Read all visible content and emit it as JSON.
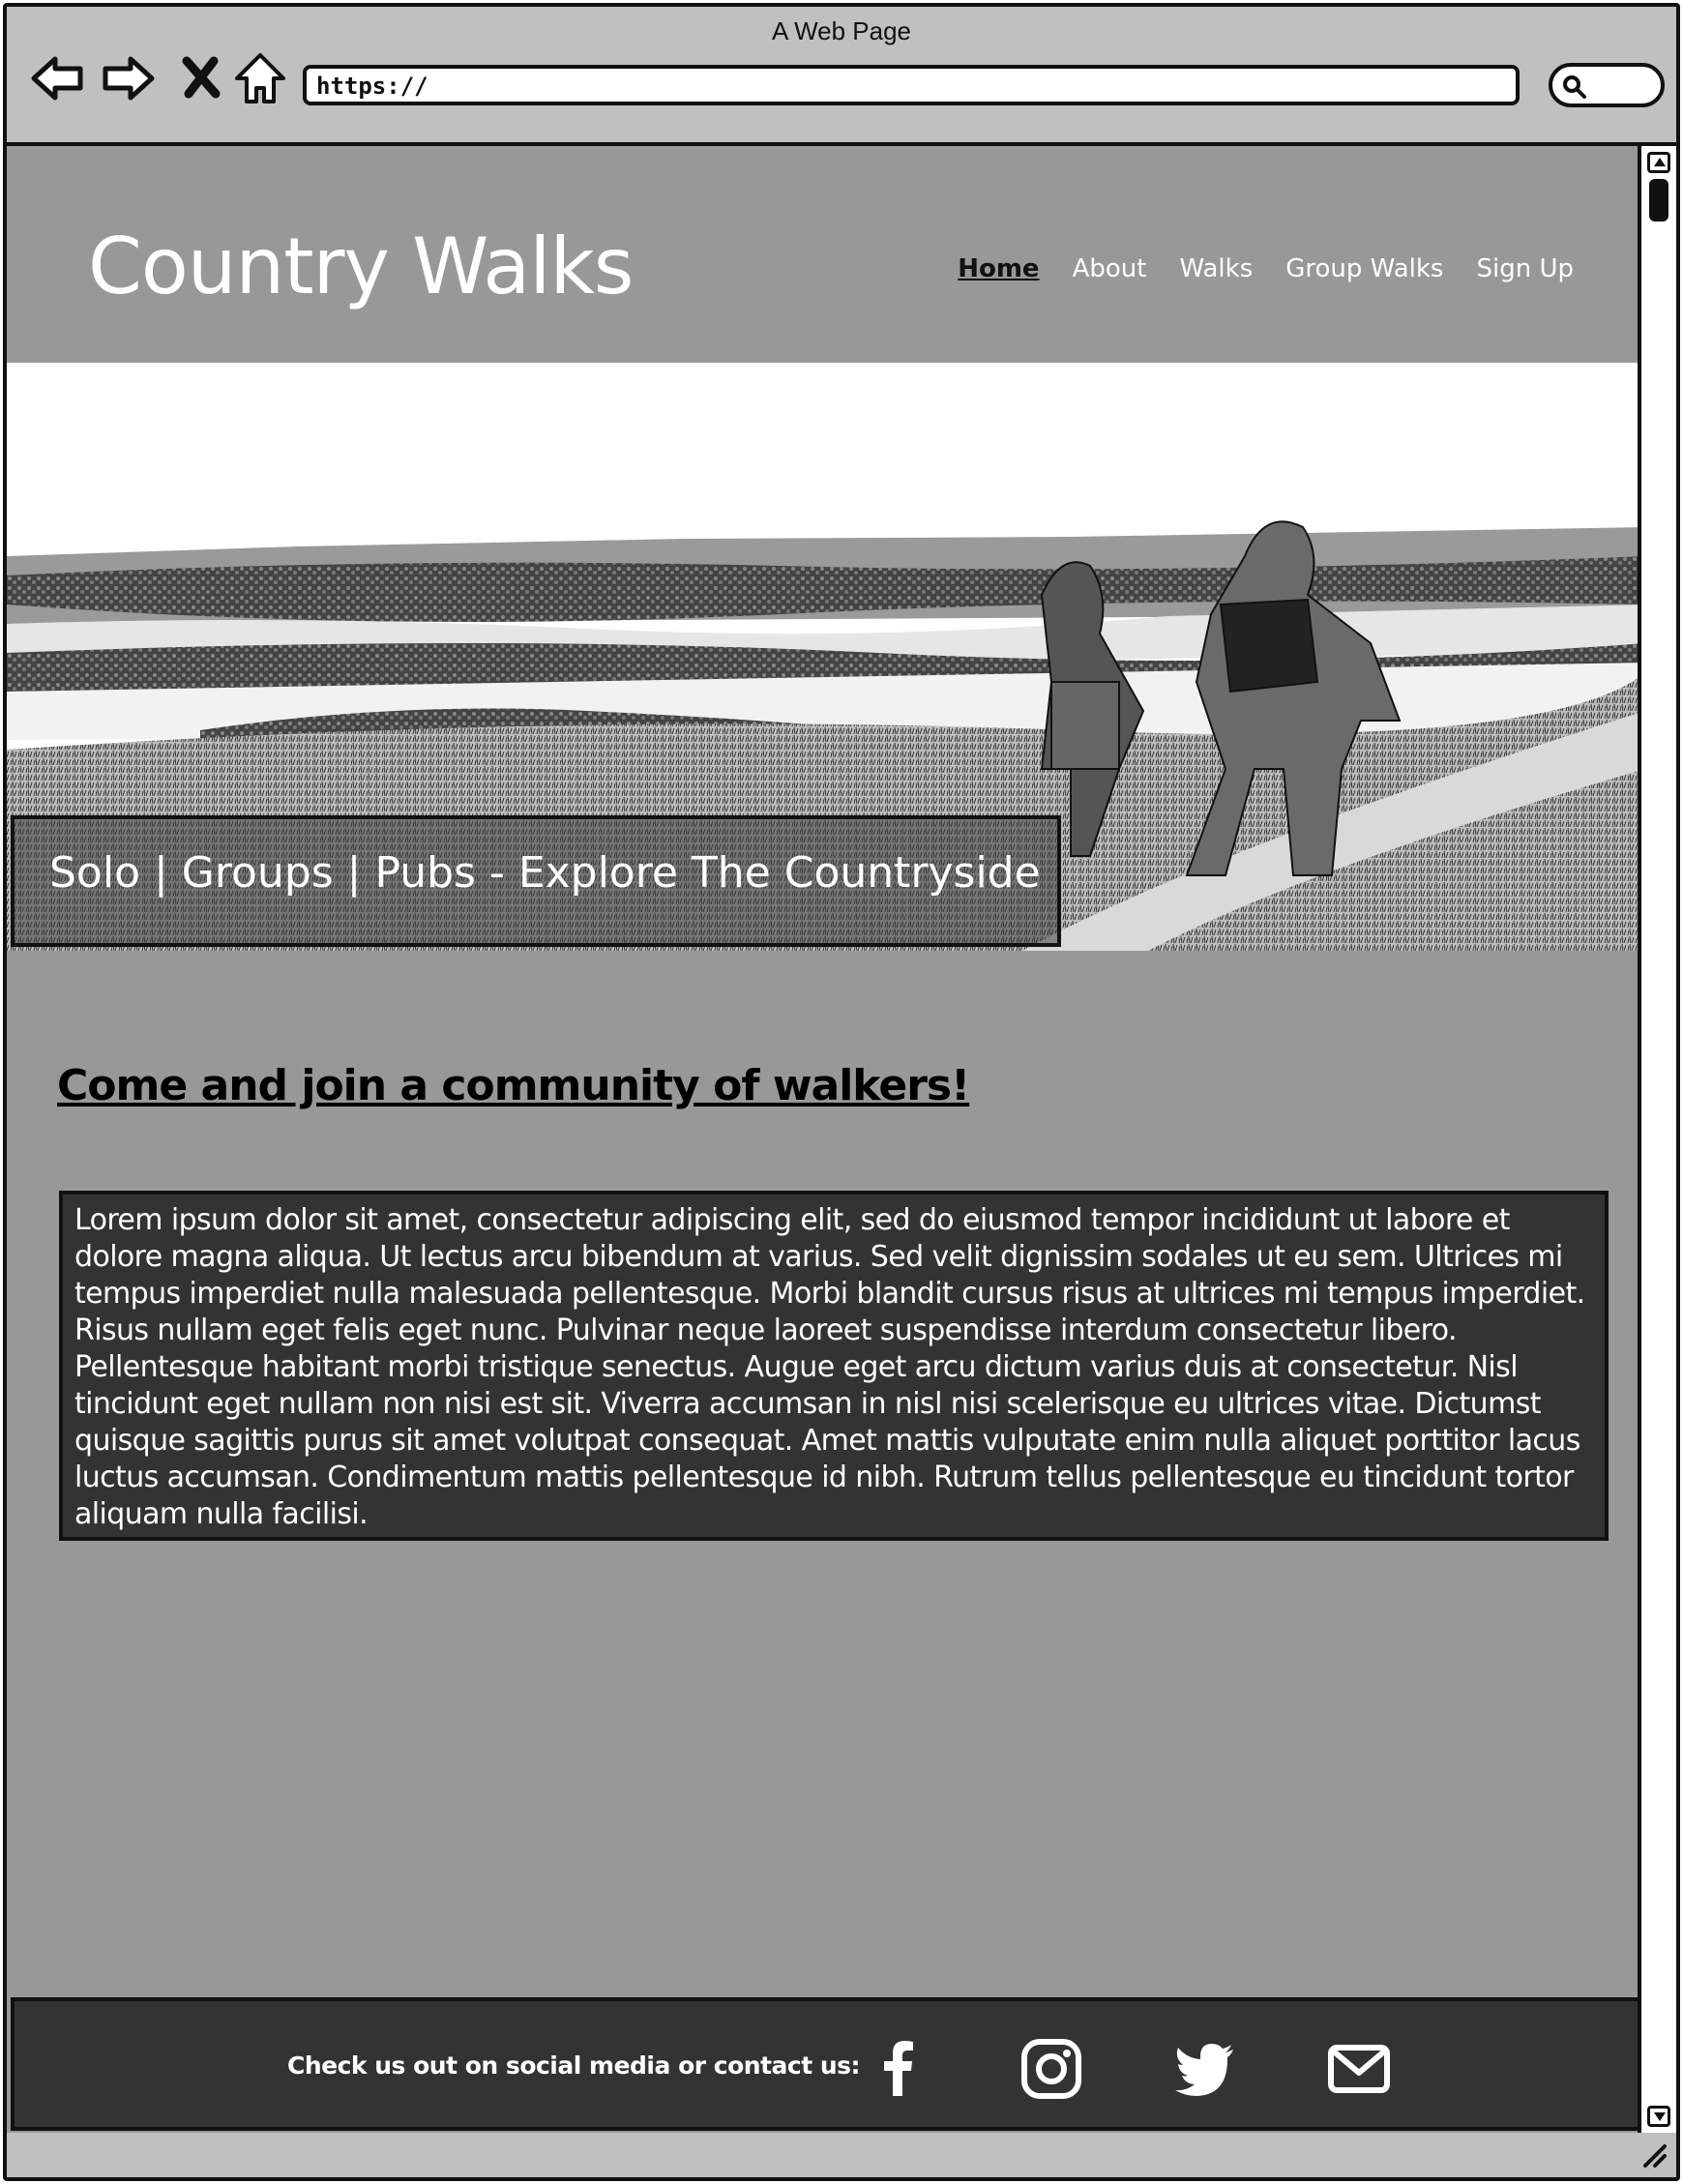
{
  "browser": {
    "window_title": "A Web Page",
    "url": "https://",
    "icons": [
      "back-arrow-icon",
      "forward-arrow-icon",
      "close-icon",
      "home-icon",
      "search-icon"
    ]
  },
  "site": {
    "title": "Country Walks",
    "nav": [
      {
        "label": "Home",
        "active": true
      },
      {
        "label": "About",
        "active": false
      },
      {
        "label": "Walks",
        "active": false
      },
      {
        "label": "Group Walks",
        "active": false
      },
      {
        "label": "Sign Up",
        "active": false
      }
    ]
  },
  "hero": {
    "caption": "Solo | Groups | Pubs - Explore The Countryside"
  },
  "main": {
    "heading": "Come and join a community of walkers!",
    "body": "Lorem ipsum dolor sit amet, consectetur adipiscing elit, sed do eiusmod tempor incididunt ut labore et dolore magna aliqua. Ut lectus arcu bibendum at varius. Sed velit dignissim sodales ut eu sem. Ultrices mi tempus imperdiet nulla malesuada pellentesque. Morbi blandit cursus risus at ultrices mi tempus imperdiet. Risus nullam eget felis eget nunc. Pulvinar neque laoreet suspendisse interdum consectetur libero. Pellentesque habitant morbi tristique senectus. Augue eget arcu dictum varius duis at consectetur. Nisl tincidunt eget nullam non nisi est sit. Viverra accumsan in nisl nisi scelerisque eu ultrices vitae. Dictumst quisque sagittis purus sit amet volutpat consequat. Amet mattis vulputate enim nulla aliquet porttitor lacus luctus accumsan. Condimentum mattis pellentesque id nibh. Rutrum tellus pellentesque eu tincidunt tortor aliquam nulla facilisi."
  },
  "footer": {
    "text": "Check us out on social media or contact us:",
    "social_icons": [
      "facebook-icon",
      "instagram-icon",
      "twitter-icon",
      "email-icon"
    ]
  },
  "colors": {
    "page_background": "#989898",
    "dark_panel": "#333333",
    "chrome": "#c0c0c0"
  }
}
